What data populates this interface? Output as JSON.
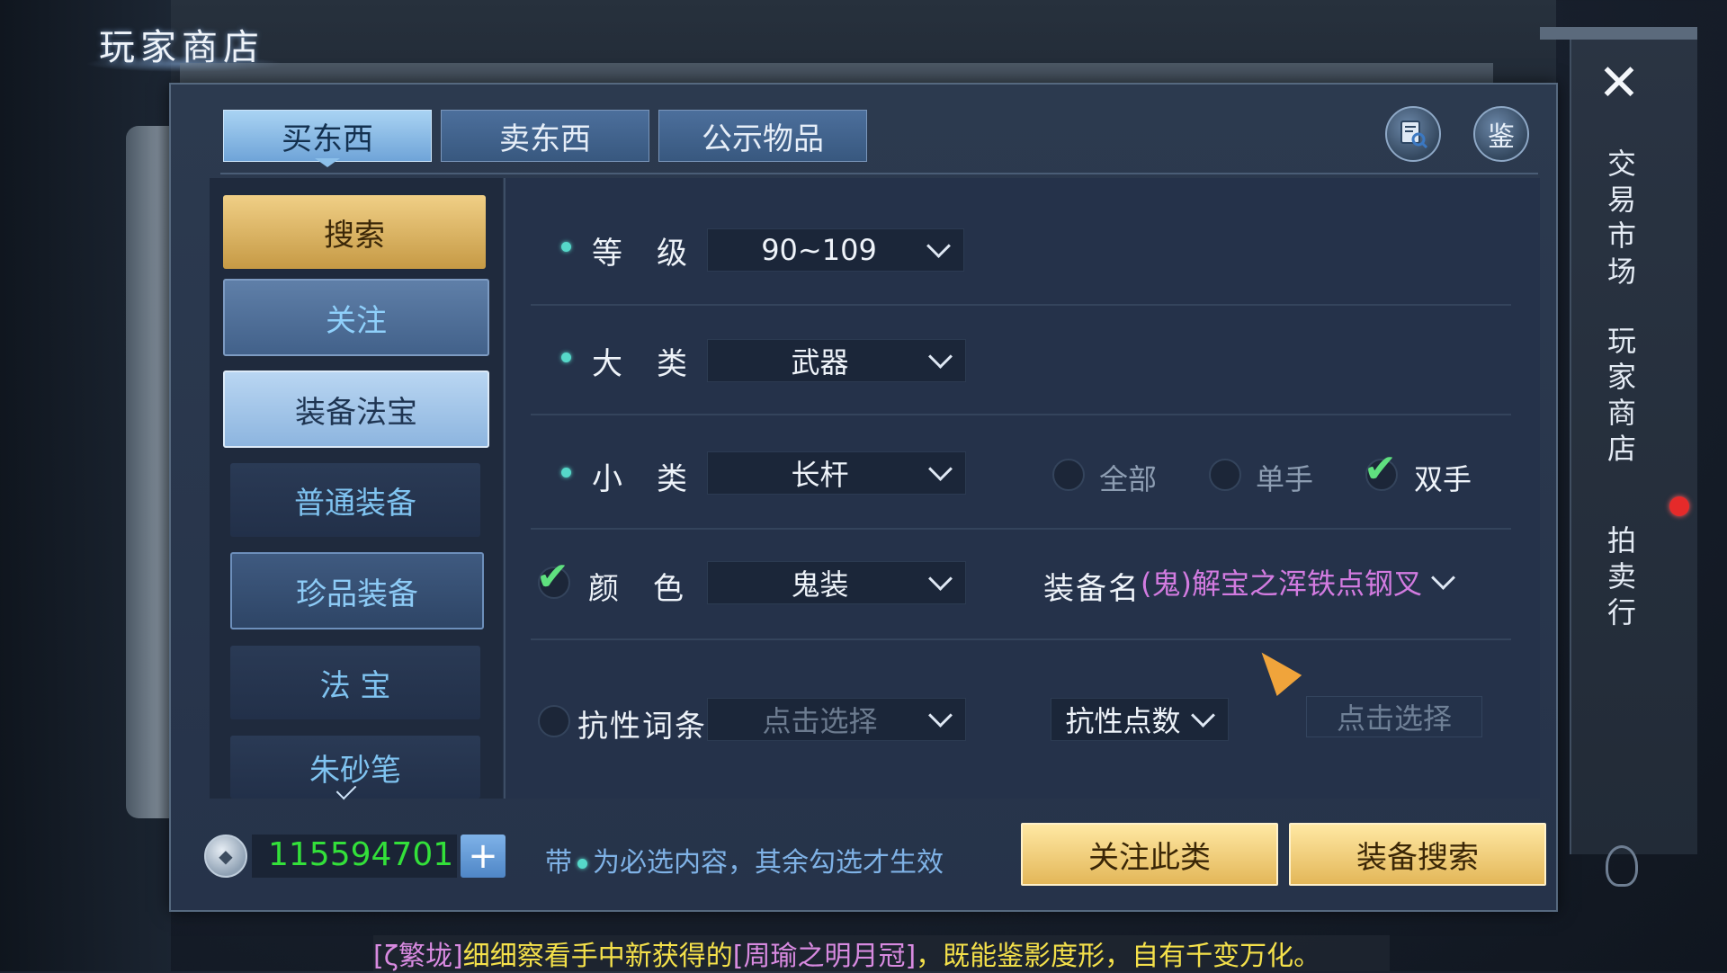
{
  "screen_title": "玩家商店",
  "tabs": [
    {
      "label": "买东西",
      "active": true
    },
    {
      "label": "卖东西",
      "active": false
    },
    {
      "label": "公示物品",
      "active": false
    }
  ],
  "header_buttons": {
    "search_records_icon": "magnifier-document-icon",
    "appraise_label": "鉴"
  },
  "sidebar": {
    "items": [
      {
        "label": "搜索",
        "state": "search"
      },
      {
        "label": "关注",
        "state": "follow"
      },
      {
        "label": "装备法宝",
        "state": "selected"
      },
      {
        "label": "普通装备",
        "state": "normal"
      },
      {
        "label": "珍品装备",
        "state": "highlight"
      },
      {
        "label": "法 宝",
        "state": "normal"
      },
      {
        "label": "朱砂笔",
        "state": "normal"
      }
    ]
  },
  "form": {
    "level": {
      "label": "等　级",
      "value": "90~109"
    },
    "category": {
      "label": "大　类",
      "value": "武器"
    },
    "subcategory": {
      "label": "小　类",
      "value": "长杆"
    },
    "hand_options": [
      {
        "label": "全部",
        "checked": false
      },
      {
        "label": "单手",
        "checked": false
      },
      {
        "label": "双手",
        "checked": true
      }
    ],
    "color": {
      "label": "颜　色",
      "value": "鬼装",
      "checked": true
    },
    "equip_name": {
      "label": "装备名",
      "value": "(鬼)解宝之浑铁点钢叉"
    },
    "resist_entry": {
      "label": "抗性词条",
      "value": "点击选择",
      "checked": false
    },
    "resist_points": {
      "label": "抗性点数",
      "value": "点击选择"
    }
  },
  "footer": {
    "currency": "115594701",
    "add_label": "+",
    "hint_prefix": "带",
    "hint_suffix": "为必选内容，其余勾选才生效",
    "follow_btn": "关注此类",
    "search_btn": "装备搜索"
  },
  "right_rail": {
    "close_label": "✕",
    "items": [
      "交易市场",
      "玩家商店",
      "拍卖行"
    ]
  },
  "chat": {
    "channel": "[ζ繁垅]",
    "text_before": "细细察看手中新获得的",
    "item": "[周瑜之明月冠]",
    "text_after": "，既能鉴影度形，自有千变万化。"
  },
  "colors": {
    "accent_teal": "#56d8c9",
    "money_green": "#33e03a",
    "equip_name_purple": "#d27be0",
    "gold_button": "#e3b759"
  }
}
